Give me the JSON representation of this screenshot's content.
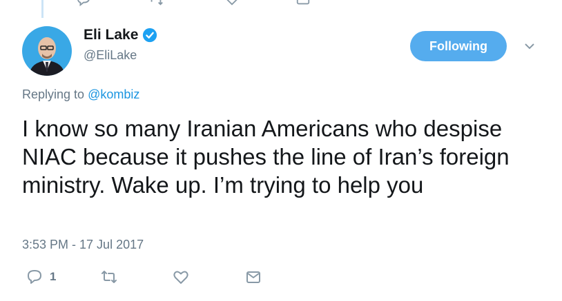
{
  "tweet": {
    "author_name": "Eli Lake",
    "author_handle": "@EliLake",
    "verified": true,
    "follow_button_label": "Following",
    "reply_prefix": "Replying to",
    "reply_to": "@kombiz",
    "text": "I know so many Iranian Americans who despise NIAC because it pushes the line of Iran’s foreign ministry. Wake up. I’m trying to help you",
    "timestamp": "3:53 PM - 17 Jul 2017",
    "reply_count": "1"
  },
  "icons": {
    "reply": "reply-icon",
    "retweet": "retweet-icon",
    "like": "heart-icon",
    "dm": "envelope-icon",
    "verified": "verified-badge-icon",
    "more": "chevron-down-icon"
  },
  "colors": {
    "accent": "#1b95e0",
    "button": "#55acee",
    "secondary_text": "#657786",
    "icon": "#8899a6",
    "text": "#14171a"
  }
}
